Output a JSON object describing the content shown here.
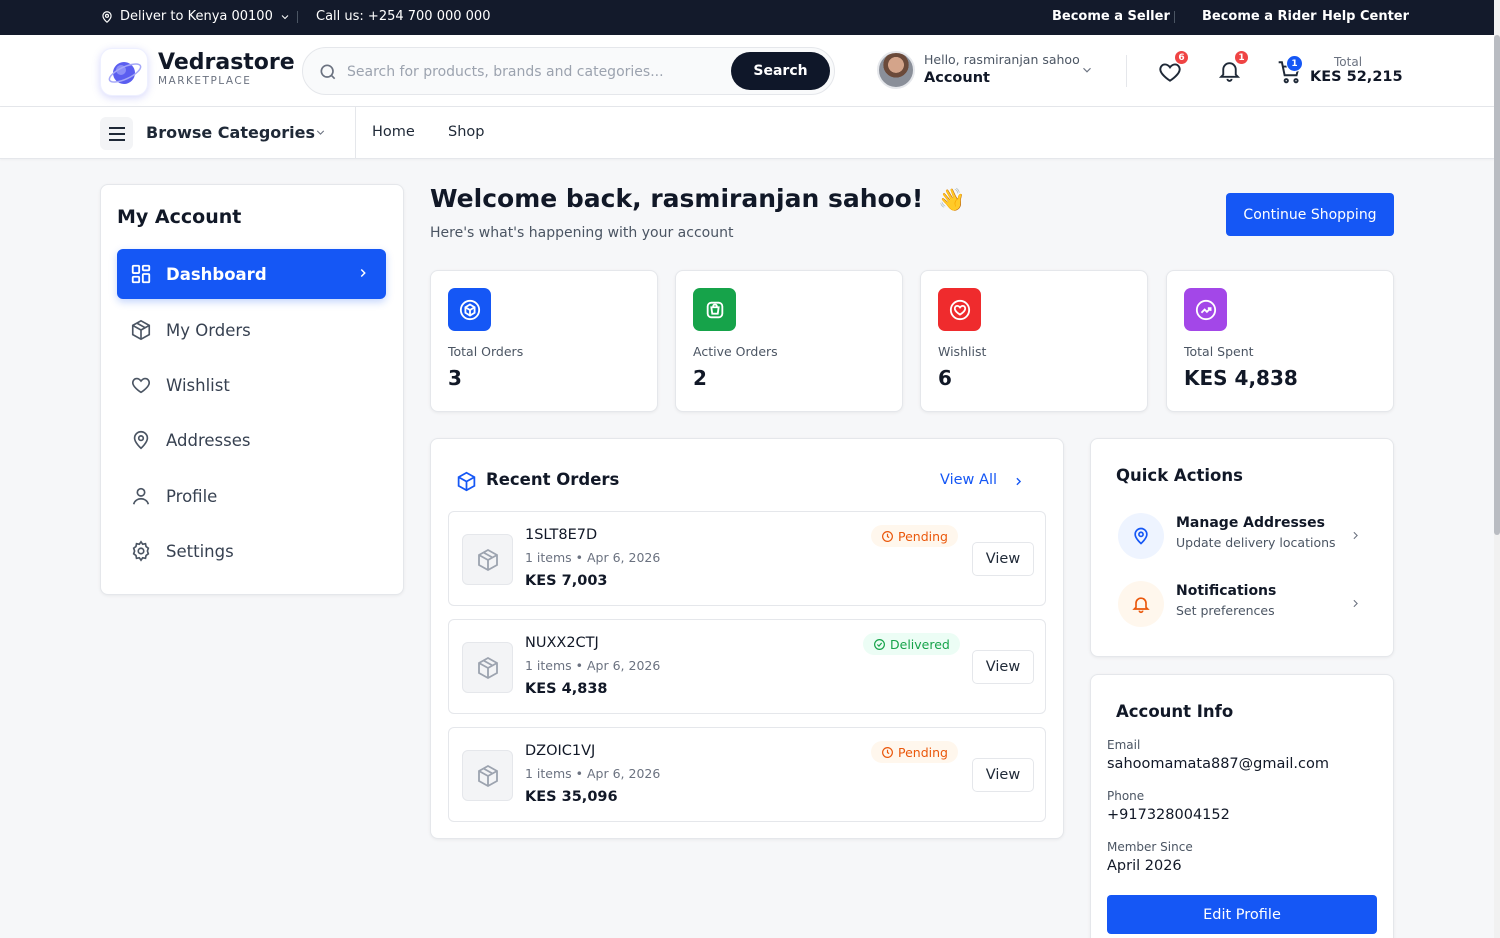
{
  "topbar": {
    "deliver": "Deliver to Kenya 00100",
    "call": "Call us: +254 700 000 000",
    "seller": "Become a Seller",
    "rider": "Become a Rider",
    "help": "Help Center"
  },
  "header": {
    "brand": "Vedrastore",
    "brand_sub": "MARKETPLACE",
    "search_placeholder": "Search for products, brands and categories...",
    "search_button": "Search",
    "hello": "Hello, rasmiranjan sahoo",
    "account": "Account",
    "wishlist_count": "6",
    "notif_count": "1",
    "cart_count": "1",
    "total_label": "Total",
    "total_value": "KES 52,215"
  },
  "nav": {
    "browse": "Browse Categories",
    "links": [
      "Home",
      "Shop"
    ]
  },
  "sidebar": {
    "title": "My Account",
    "items": [
      {
        "label": "Dashboard",
        "icon": "grid-icon"
      },
      {
        "label": "My Orders",
        "icon": "package-icon"
      },
      {
        "label": "Wishlist",
        "icon": "heart-icon"
      },
      {
        "label": "Addresses",
        "icon": "map-pin-icon"
      },
      {
        "label": "Profile",
        "icon": "user-icon"
      },
      {
        "label": "Settings",
        "icon": "gear-icon"
      }
    ]
  },
  "welcome": {
    "title": "Welcome back, rasmiranjan sahoo!",
    "emoji": "👋",
    "subtitle": "Here's what's happening with your account",
    "continue": "Continue Shopping"
  },
  "stats": [
    {
      "label": "Total Orders",
      "value": "3",
      "color": "#1557f5"
    },
    {
      "label": "Active Orders",
      "value": "2",
      "color": "#16a34a"
    },
    {
      "label": "Wishlist",
      "value": "6",
      "color": "#ef2b2d"
    },
    {
      "label": "Total Spent",
      "value": "KES 4,838",
      "color": "#a347e8"
    }
  ],
  "orders": {
    "title": "Recent Orders",
    "view_all": "View All",
    "items": [
      {
        "id": "1SLT8E7D",
        "meta": "1 items • Apr 6, 2026",
        "amount": "KES 7,003",
        "status": "Pending",
        "view": "View"
      },
      {
        "id": "NUXX2CTJ",
        "meta": "1 items • Apr 6, 2026",
        "amount": "KES 4,838",
        "status": "Delivered",
        "view": "View"
      },
      {
        "id": "DZOIC1VJ",
        "meta": "1 items • Apr 6, 2026",
        "amount": "KES 35,096",
        "status": "Pending",
        "view": "View"
      }
    ]
  },
  "quick_actions": {
    "title": "Quick Actions",
    "items": [
      {
        "title": "Manage Addresses",
        "sub": "Update delivery locations"
      },
      {
        "title": "Notifications",
        "sub": "Set preferences"
      }
    ]
  },
  "account_info": {
    "title": "Account Info",
    "email_label": "Email",
    "email": "sahoomamata887@gmail.com",
    "phone_label": "Phone",
    "phone": "+917328004152",
    "since_label": "Member Since",
    "since": "April 2026",
    "edit": "Edit Profile"
  },
  "colors": {
    "primary": "#1557f5",
    "dark": "#131a2b",
    "pending": "#ea580c",
    "delivered": "#16a34a"
  }
}
